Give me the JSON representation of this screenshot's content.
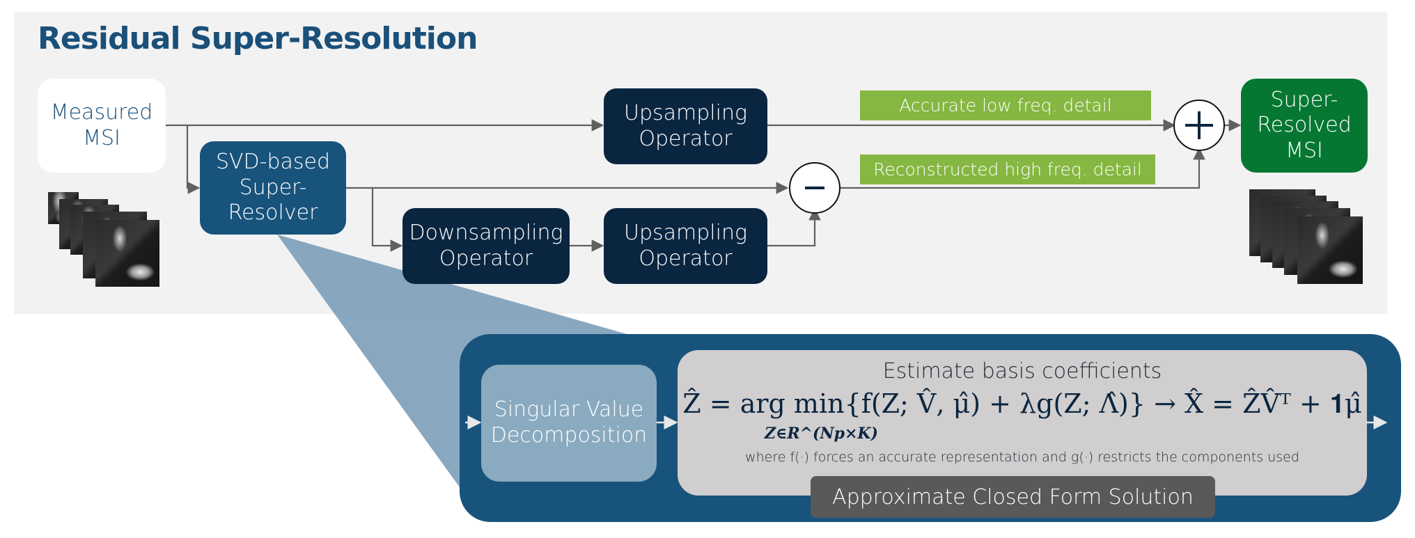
{
  "title": "Residual Super-Resolution",
  "nodes": {
    "measured_msi": "Measured\nMSI",
    "svd_super_resolver": "SVD-based\nSuper-\nResolver",
    "upsampling_top": "Upsampling\nOperator",
    "downsampling": "Downsampling\nOperator",
    "upsampling_bottom": "Upsampling\nOperator",
    "super_resolved_msi": "Super-\nResolved\nMSI"
  },
  "operators": {
    "subtract": "−",
    "add": "+"
  },
  "labels": {
    "low_freq": "Accurate low freq. detail",
    "high_freq": "Reconstructed high freq. detail"
  },
  "detail": {
    "svd_box": "Singular Value\nDecomposition",
    "formula_title": "Estimate basis coefficients",
    "formula": "Ẑ = arg min{f(Z; V̂, μ̂) + λg(Z; Λ̂)} → X̂ = ẐV̂ᵀ + 𝟏μ̂",
    "formula_subscript": "Z∈R^(Np×K)",
    "formula_note": "where f(·) forces an accurate representation and g(·) restricts the components used",
    "closed_form_label": "Approximate Closed Form Solution"
  },
  "images": {
    "input_stack_frames": 5,
    "output_stack_frames": 5,
    "description": "grayscale multispectral image stack"
  },
  "colors": {
    "title": "#1a5079",
    "navy_box": "#0a2540",
    "svd_box": "#18537c",
    "output_box": "#067733",
    "label_green": "#86b742",
    "panel_gray": "#f2f2f2",
    "detail_panel": "#18537c",
    "svd_inner": "#8aaabf",
    "formula_box": "#d0cece",
    "closed_form": "#595959"
  }
}
